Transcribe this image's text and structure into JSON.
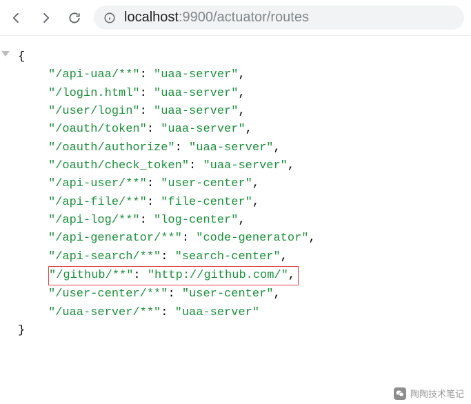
{
  "browser": {
    "url_host": "localhost",
    "url_rest": ":9900/actuator/routes"
  },
  "json": {
    "open": "{",
    "close": "}",
    "entries": [
      {
        "key": "/api-uaa/**",
        "value": "uaa-server",
        "highlight": false,
        "comma": true
      },
      {
        "key": "/login.html",
        "value": "uaa-server",
        "highlight": false,
        "comma": true
      },
      {
        "key": "/user/login",
        "value": "uaa-server",
        "highlight": false,
        "comma": true
      },
      {
        "key": "/oauth/token",
        "value": "uaa-server",
        "highlight": false,
        "comma": true
      },
      {
        "key": "/oauth/authorize",
        "value": "uaa-server",
        "highlight": false,
        "comma": true
      },
      {
        "key": "/oauth/check_token",
        "value": "uaa-server",
        "highlight": false,
        "comma": true
      },
      {
        "key": "/api-user/**",
        "value": "user-center",
        "highlight": false,
        "comma": true
      },
      {
        "key": "/api-file/**",
        "value": "file-center",
        "highlight": false,
        "comma": true
      },
      {
        "key": "/api-log/**",
        "value": "log-center",
        "highlight": false,
        "comma": true
      },
      {
        "key": "/api-generator/**",
        "value": "code-generator",
        "highlight": false,
        "comma": true
      },
      {
        "key": "/api-search/**",
        "value": "search-center",
        "highlight": false,
        "comma": true
      },
      {
        "key": "/github/**",
        "value": "http://github.com/",
        "highlight": true,
        "comma": true
      },
      {
        "key": "/user-center/**",
        "value": "user-center",
        "highlight": false,
        "comma": true
      },
      {
        "key": "/uaa-server/**",
        "value": "uaa-server",
        "highlight": false,
        "comma": false
      }
    ]
  },
  "watermark": {
    "text": "陶陶技术笔记"
  }
}
